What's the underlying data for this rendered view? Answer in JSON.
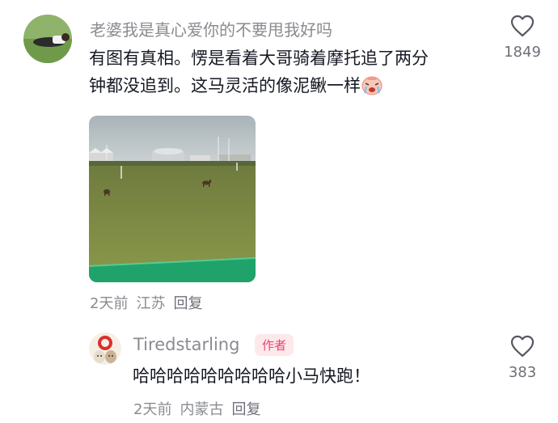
{
  "comments": [
    {
      "username": "老婆我是真心爱你的不要甩我好吗",
      "text_line1": "有图有真相。愣是看着大哥骑着摩托追了两分",
      "text_line2": "钟都没追到。这马灵活的像泥鳅一样",
      "emoji": "crying-face-emoji",
      "time": "2天前",
      "location": "江苏",
      "reply_label": "回复",
      "likes": "1849"
    },
    {
      "username": "Tiredstarling",
      "author_tag": "作者",
      "text": "哈哈哈哈哈哈哈哈哈小马快跑！",
      "time": "2天前",
      "location": "内蒙古",
      "reply_label": "回复",
      "likes": "383"
    }
  ],
  "colors": {
    "secondary_text": "#8a8b91",
    "primary_text": "#161823",
    "author_tag_bg": "#fde9ec",
    "author_tag_text": "#f2416b"
  }
}
